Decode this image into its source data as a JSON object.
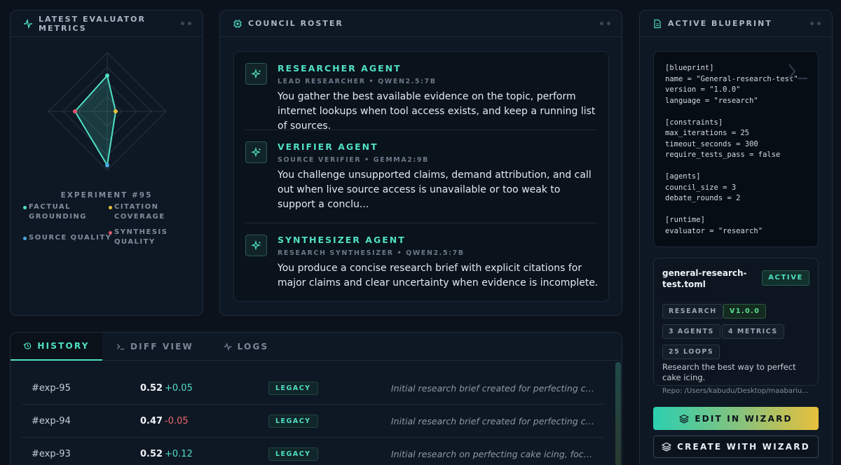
{
  "metrics_panel": {
    "title": "LATEST EVALUATOR METRICS",
    "experiment": "EXPERIMENT #95",
    "legend": [
      {
        "label": "FACTUAL GROUNDING",
        "color": "#4fe0c3"
      },
      {
        "label": "CITATION COVERAGE",
        "color": "#e7c03c"
      },
      {
        "label": "SOURCE QUALITY",
        "color": "#4aa8e6"
      },
      {
        "label": "SYNTHESIS QUALITY",
        "color": "#e0566b"
      }
    ]
  },
  "council": {
    "title": "COUNCIL ROSTER",
    "agents": [
      {
        "name": "RESEARCHER AGENT",
        "role": "LEAD RESEARCHER • QWEN2.5:7B",
        "description": "You gather the best available evidence on the topic, perform internet lookups when tool access exists, and keep a running list of sources."
      },
      {
        "name": "VERIFIER AGENT",
        "role": "SOURCE VERIFIER • GEMMA2:9B",
        "description": "You challenge unsupported claims, demand attribution, and call out when live source access is unavailable or too weak to support a conclu..."
      },
      {
        "name": "SYNTHESIZER AGENT",
        "role": "RESEARCH SYNTHESIZER • QWEN2.5:7B",
        "description": "You produce a concise research brief with explicit citations for major claims and clear uncertainty when evidence is incomplete."
      }
    ]
  },
  "history": {
    "tabs": [
      {
        "label": "HISTORY",
        "icon": "history-icon"
      },
      {
        "label": "DIFF VIEW",
        "icon": "terminal-icon"
      },
      {
        "label": "LOGS",
        "icon": "activity-icon"
      }
    ],
    "rows": [
      {
        "id": "#exp-95",
        "score": "0.52",
        "delta": "+0.05",
        "delta_color": "#4fe0c3",
        "badge": "LEGACY",
        "note": "Initial research brief created for perfecting cake icing."
      },
      {
        "id": "#exp-94",
        "score": "0.47",
        "delta": "-0.05",
        "delta_color": "#ef6b6b",
        "badge": "LEGACY",
        "note": "Initial research brief created for perfecting cake icing."
      },
      {
        "id": "#exp-93",
        "score": "0.52",
        "delta": "+0.12",
        "delta_color": "#4fe0c3",
        "badge": "LEGACY",
        "note": "Initial research on perfecting cake icing, focusing on techniques."
      }
    ]
  },
  "blueprint": {
    "title": "ACTIVE BLUEPRINT",
    "code": "[blueprint]\nname = \"General-research-test\"\nversion = \"1.0.0\"\nlanguage = \"research\"\n\n[constraints]\nmax_iterations = 25\ntimeout_seconds = 300\nrequire_tests_pass = false\n\n[agents]\ncouncil_size = 3\ndebate_rounds = 2\n\n[runtime]\nevaluator = \"research\"",
    "file_name": "general-research-test.toml",
    "status": "ACTIVE",
    "chips": {
      "type": "RESEARCH",
      "version": "V1.0.0",
      "agents": "3 AGENTS",
      "metrics": "4 METRICS",
      "loops": "25 LOOPS"
    },
    "description": "Research the best way to perfect cake icing.",
    "repo": "Repo: /Users/kabudu/Desktop/maabarium/blueprints",
    "edit_button": "EDIT IN WIZARD",
    "create_button": "CREATE WITH WIZARD"
  },
  "colors": {
    "accent": "#4fe0c3",
    "gold": "#e7c03c",
    "background": "#0b121c"
  }
}
